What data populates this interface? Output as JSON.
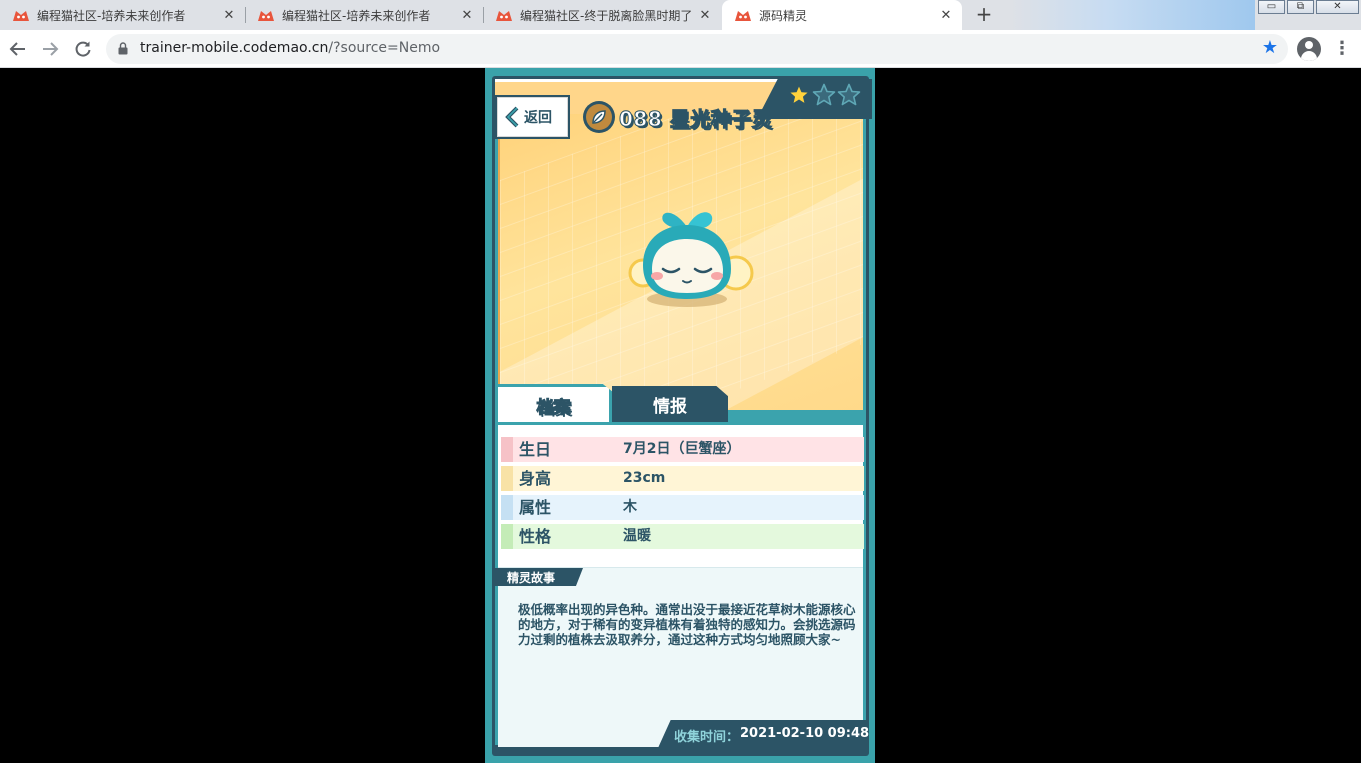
{
  "browser": {
    "tabs": [
      {
        "title": "编程猫社区-培养未来创作者",
        "active": false
      },
      {
        "title": "编程猫社区-培养未来创作者",
        "active": false
      },
      {
        "title": "编程猫社区-终于脱离脸黑时期了",
        "active": false
      },
      {
        "title": "源码精灵",
        "active": true
      }
    ],
    "close_glyph": "✕",
    "new_tab_glyph": "+",
    "url_host": "trainer-mobile.codemao.cn",
    "url_path": "/?source=Nemo",
    "window_controls": {
      "minimize": "▭",
      "restore": "⧉",
      "close": "✕"
    }
  },
  "card": {
    "back_label": "返回",
    "title": "088 星光种子灵",
    "stars_filled": 1,
    "stars_total": 3,
    "tabs": {
      "archive": "档案",
      "info": "情报"
    },
    "attributes": [
      {
        "label": "生日",
        "value": "7月2日（巨蟹座）",
        "bg": "#ffe3e6",
        "stub": "#f6c2c7"
      },
      {
        "label": "身高",
        "value": "23cm",
        "bg": "#fff5d6",
        "stub": "#f8e2a6"
      },
      {
        "label": "属性",
        "value": "木",
        "bg": "#e6f3fc",
        "stub": "#c5e0f3"
      },
      {
        "label": "性格",
        "value": "温暖",
        "bg": "#e4f9dd",
        "stub": "#c4ecb7"
      }
    ],
    "story_title": "精灵故事",
    "story_text": "极低概率出现的异色种。通常出没于最接近花草树木能源核心的地方，对于稀有的变异植株有着独特的感知力。会挑选源码力过剩的植株去汲取养分，通过这种方式均匀地照顾大家~",
    "collect_label": "收集时间：",
    "collect_time": "2021-02-10 09:48"
  },
  "colors": {
    "navy": "#2c5466",
    "teal": "#3ba3ad",
    "accent_blue": "#1a73e8"
  }
}
